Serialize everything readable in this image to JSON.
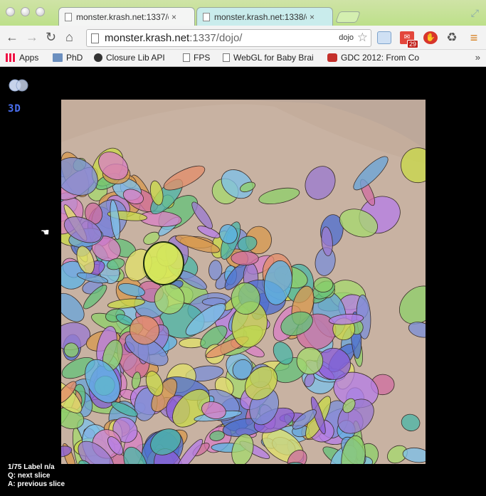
{
  "tabs": [
    {
      "title": "monster.krash.net:1337/d",
      "close": "×",
      "active": true
    },
    {
      "title": "monster.krash.net:1338/d",
      "close": "×",
      "active": false
    }
  ],
  "toolbar": {
    "back": "←",
    "forward": "→",
    "reload": "↻",
    "home": "⌂",
    "url_host": "monster.krash.net",
    "url_rest": ":1337/dojo/",
    "search_hint": "dojo",
    "star": "☆",
    "mail_badge": "29"
  },
  "bookmarks": [
    {
      "label": "Apps",
      "icon": "apps-icon"
    },
    {
      "label": "PhD",
      "icon": "folder-icon"
    },
    {
      "label": "Closure Lib API",
      "icon": "closure-icon"
    },
    {
      "label": "FPS",
      "icon": "page-icon"
    },
    {
      "label": "WebGL for Baby Brai",
      "icon": "page-icon"
    },
    {
      "label": "GDC 2012: From Co",
      "icon": "youtube-icon"
    }
  ],
  "bookmarks_more": "»",
  "viewer": {
    "mode_label": "3D",
    "status": [
      "1/75 Label n/a",
      "Q: next slice",
      "A: previous slice"
    ],
    "segment_colors": [
      "#7c8fd6",
      "#6aa5d9",
      "#8fd06a",
      "#d79a4f",
      "#c9d94a",
      "#9b7bd0",
      "#d882c4",
      "#4db6a6",
      "#e0e06a",
      "#8a5fd8",
      "#5fb4e4",
      "#d06fa0",
      "#66c27a",
      "#b67fe6",
      "#7ec0e8",
      "#e38e6a",
      "#4f6fcf",
      "#a6d86e"
    ]
  }
}
